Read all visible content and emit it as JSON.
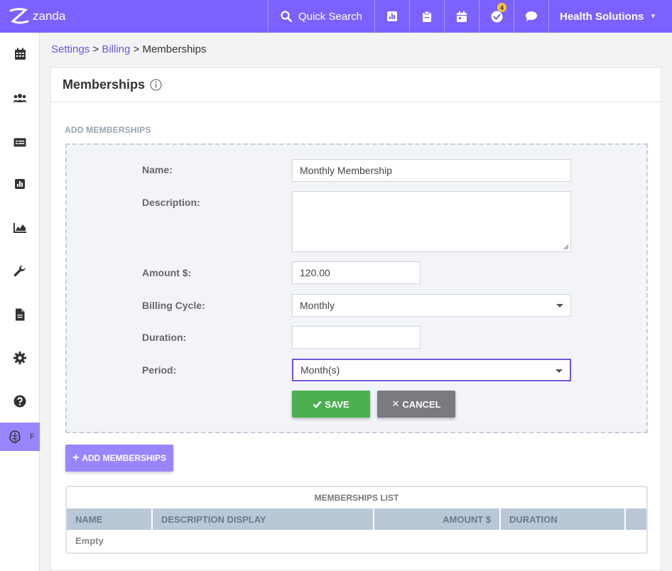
{
  "topbar": {
    "logo_text": "zanda",
    "search_label": "Quick Search",
    "notifications_count": "4",
    "org_name": "Health Solutions",
    "icons": [
      "search-icon",
      "reports-icon",
      "clipboard-icon",
      "calendar-icon",
      "tasks-icon",
      "chat-icon"
    ]
  },
  "sidebar": {
    "items": [
      "calendar-icon",
      "clients-icon",
      "billing-card-icon",
      "reports-icon",
      "analytics-icon",
      "tools-icon",
      "document-icon",
      "settings-icon",
      "help-icon",
      "brain-icon"
    ],
    "active_letter": "F"
  },
  "breadcrumb": {
    "settings": "Settings",
    "sep1": " > ",
    "billing": "Billing",
    "sep2": " > ",
    "current": "Memberships"
  },
  "card": {
    "title": "Memberships",
    "section_label": "ADD MEMBERSHIPS",
    "form": {
      "name_label": "Name:",
      "name_value": "Monthly Membership",
      "description_label": "Description:",
      "description_value": "",
      "amount_label": "Amount $:",
      "amount_value": "120.00",
      "billing_cycle_label": "Billing Cycle:",
      "billing_cycle_value": "Monthly",
      "duration_label": "Duration:",
      "duration_value": "",
      "period_label": "Period:",
      "period_value": "Month(s)",
      "save_label": "SAVE",
      "cancel_label": "CANCEL"
    },
    "add_button_label": "ADD MEMBERSHIPS",
    "list": {
      "title": "MEMBERSHIPS LIST",
      "columns": [
        "NAME",
        "DESCRIPTION DISPLAY",
        "AMOUNT $",
        "DURATION",
        ""
      ],
      "empty_text": "Empty"
    }
  },
  "colors": {
    "brand": "#7b61ff",
    "brand_light": "#9b85ff",
    "save": "#4caf50",
    "cancel": "#7a7a80",
    "table_header": "#b9c7d6"
  }
}
